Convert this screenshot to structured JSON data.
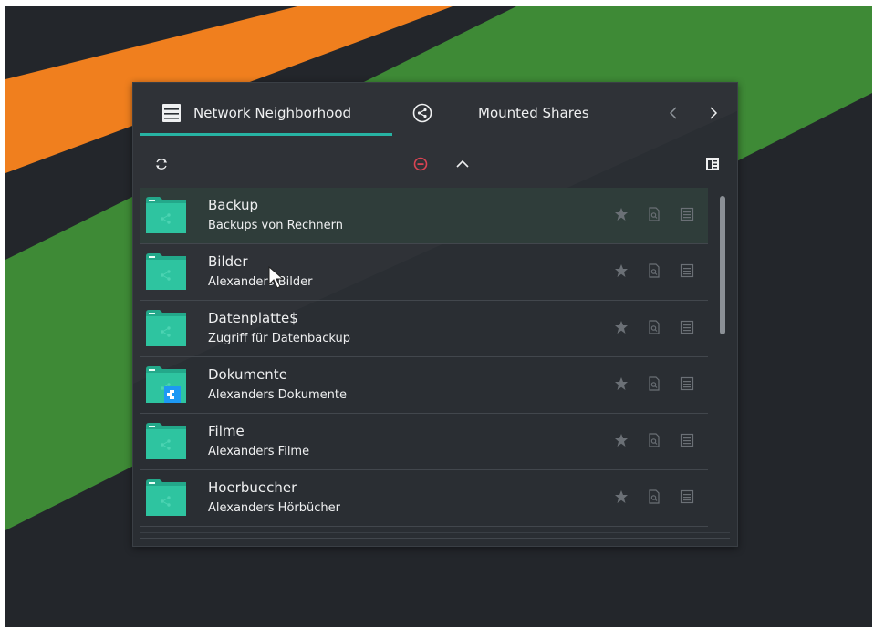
{
  "colors": {
    "desktop_bg": "#23262b",
    "stripe_orange": "#f07f1e",
    "stripe_green": "#3e8a36",
    "panel_bg": "#2a2e33",
    "accent": "#27b3a3",
    "folder": "#2ec4a0",
    "text": "#eff0f1",
    "icon_muted": "#6b7076",
    "unmount_red": "#da4453"
  },
  "tabs": [
    {
      "label": "Network Neighborhood",
      "icon": "network-server-icon",
      "active": true
    },
    {
      "label": "Mounted Shares",
      "icon": "share-icon",
      "active": false
    }
  ],
  "nav": {
    "prev_icon": "chevron-left-icon",
    "next_icon": "chevron-right-icon"
  },
  "toolbar": {
    "refresh_icon": "refresh-icon",
    "unmount_icon": "unmount-icon",
    "up_icon": "chevron-up-icon",
    "config_icon": "configure-icon"
  },
  "shares": [
    {
      "name": "Backup",
      "description": "Backups von Rechnern",
      "mounted": false
    },
    {
      "name": "Bilder",
      "description": "Alexanders Bilder",
      "mounted": false
    },
    {
      "name": "Datenplatte$",
      "description": "Zugriff für Datenbackup",
      "mounted": false
    },
    {
      "name": "Dokumente",
      "description": "Alexanders Dokumente",
      "mounted": true
    },
    {
      "name": "Filme",
      "description": "Alexanders Filme",
      "mounted": false
    },
    {
      "name": "Hoerbuecher",
      "description": "Alexanders Hörbücher",
      "mounted": false
    }
  ],
  "row_actions": [
    "bookmark-icon",
    "preview-icon",
    "properties-icon"
  ]
}
